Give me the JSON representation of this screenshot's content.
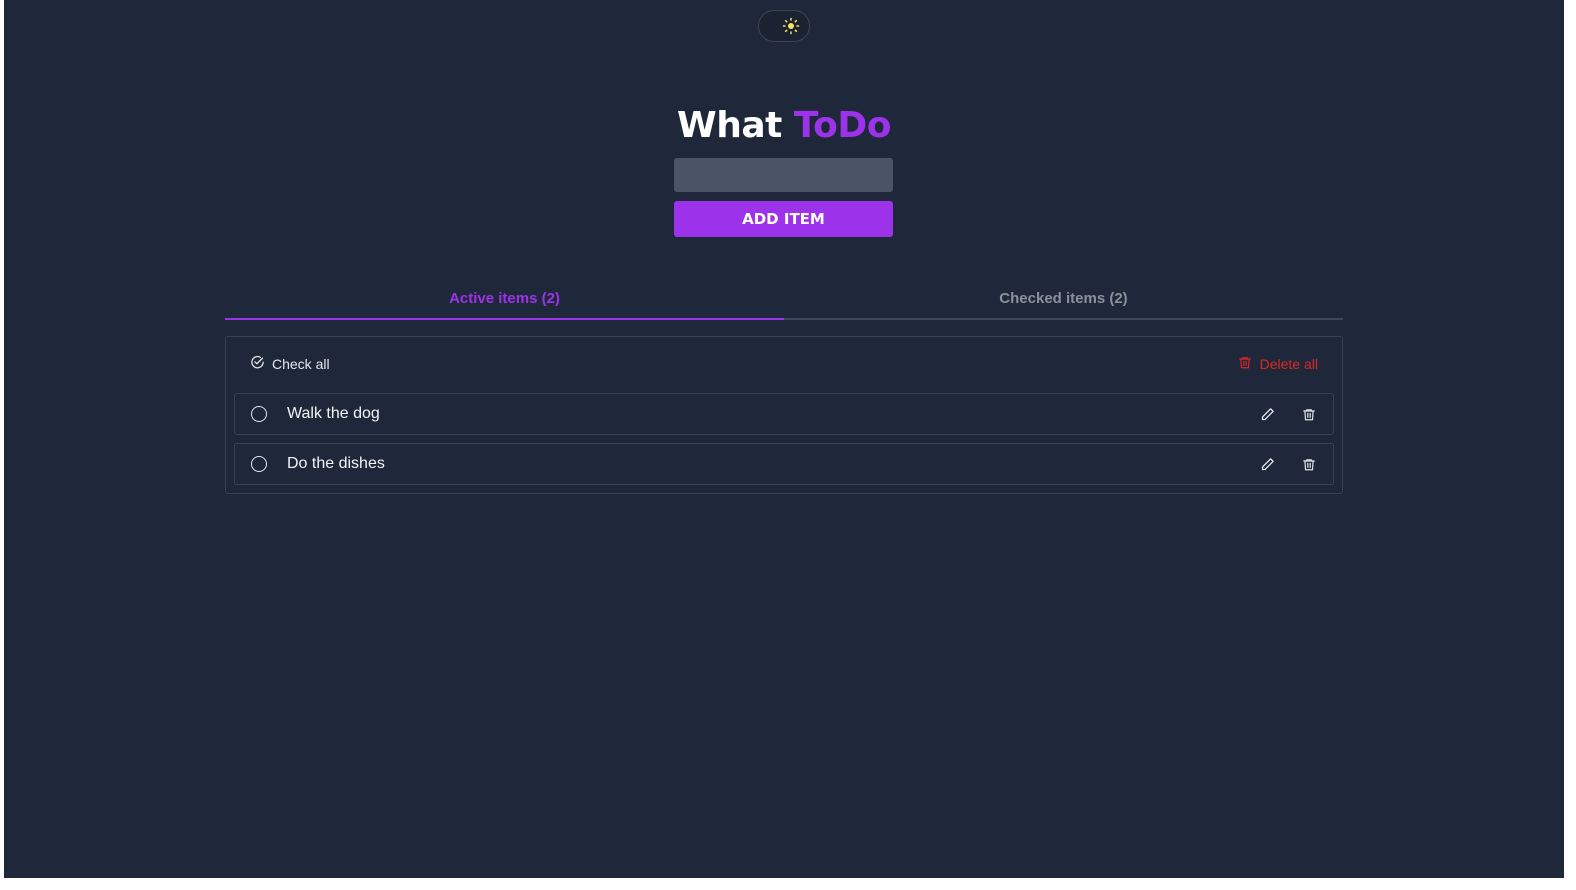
{
  "theme_toggle": {
    "icon": "sun-icon",
    "icon_color": "#fbe05b"
  },
  "header": {
    "title_part1": "What",
    "title_part2": "ToDo",
    "accent_color": "#9c33ea"
  },
  "form": {
    "input_value": "",
    "input_placeholder": "",
    "add_label": "ADD ITEM"
  },
  "tabs": [
    {
      "label": "Active items (2)",
      "active": true
    },
    {
      "label": "Checked items (2)",
      "active": false
    }
  ],
  "list": {
    "check_all_label": "Check all",
    "delete_all_label": "Delete all",
    "delete_color": "#dc2626",
    "items": [
      {
        "text": "Walk the dog"
      },
      {
        "text": "Do the dishes"
      }
    ]
  }
}
